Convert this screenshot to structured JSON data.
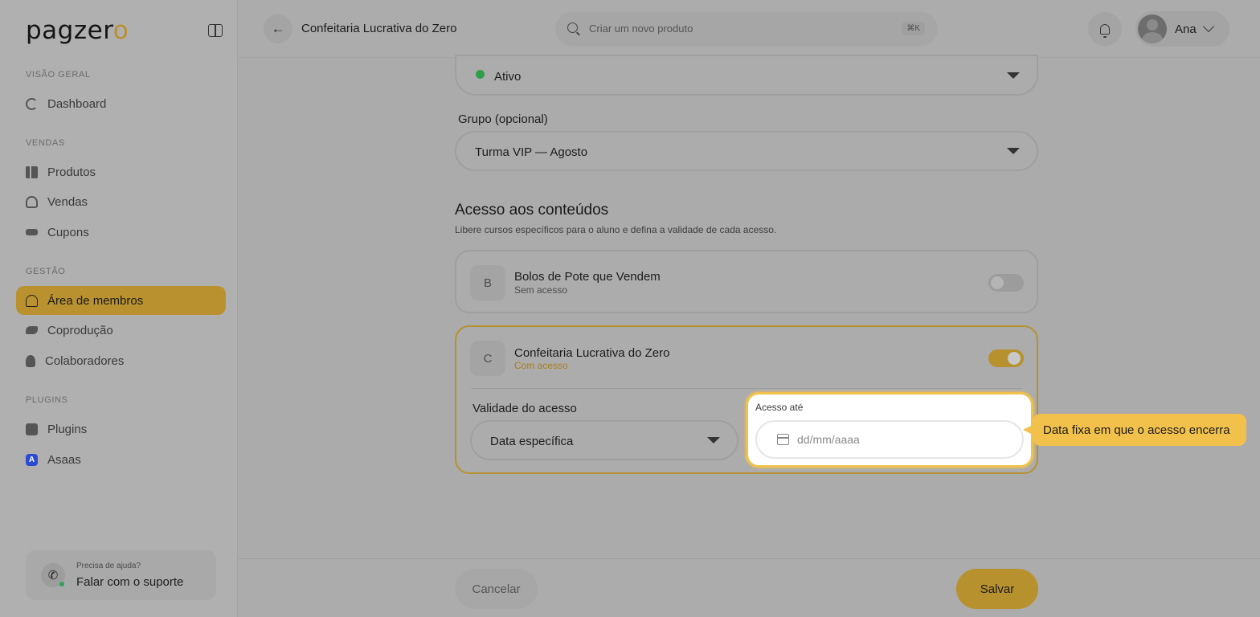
{
  "brand": {
    "logo_main": "pagzer",
    "logo_o": "o"
  },
  "sidebar": {
    "sections": [
      {
        "label": "VISÃO GERAL"
      },
      {
        "label": "VENDAS"
      },
      {
        "label": "GESTÃO"
      },
      {
        "label": "PLUGINS"
      }
    ],
    "items": [
      {
        "label": "Dashboard",
        "icon": "dashboard-icon"
      },
      {
        "label": "Produtos",
        "icon": "products-icon"
      },
      {
        "label": "Vendas",
        "icon": "sales-icon"
      },
      {
        "label": "Cupons",
        "icon": "coupon-icon"
      },
      {
        "label": "Área de membros",
        "icon": "members-icon",
        "active": true
      },
      {
        "label": "Coprodução",
        "icon": "handshake-icon"
      },
      {
        "label": "Colaboradores",
        "icon": "user-icon"
      },
      {
        "label": "Plugins",
        "icon": "puzzle-icon"
      },
      {
        "label": "Asaas",
        "icon": "asaas-icon"
      }
    ],
    "help": {
      "small": "Precisa de ajuda?",
      "big": "Falar com o suporte"
    }
  },
  "header": {
    "title": "Confeitaria Lucrativa do Zero",
    "search_placeholder": "Criar um novo produto",
    "shortcut": "⌘K",
    "user_name": "Ana"
  },
  "form": {
    "status_value": "Ativo",
    "group_label": "Grupo (opcional)",
    "group_value": "Turma VIP — Agosto"
  },
  "access": {
    "heading": "Acesso aos conteúdos",
    "subheading": "Libere cursos específicos para o aluno e defina a validade de cada acesso.",
    "courses": [
      {
        "initial": "B",
        "title": "Bolos de Pote que Vendem",
        "status": "Sem acesso",
        "enabled": false
      },
      {
        "initial": "C",
        "title": "Confeitaria Lucrativa do Zero",
        "status": "Com acesso",
        "enabled": true
      }
    ],
    "validity_label": "Validade do acesso",
    "validity_value": "Data específica",
    "until_label": "Acesso até",
    "date_placeholder": "dd/mm/aaaa",
    "tooltip": "Data fixa em que o acesso encerra"
  },
  "footer": {
    "cancel": "Cancelar",
    "save": "Salvar"
  },
  "colors": {
    "accent": "#b8912f",
    "highlight": "#f2c14c",
    "status_green": "#2f9e4a"
  }
}
